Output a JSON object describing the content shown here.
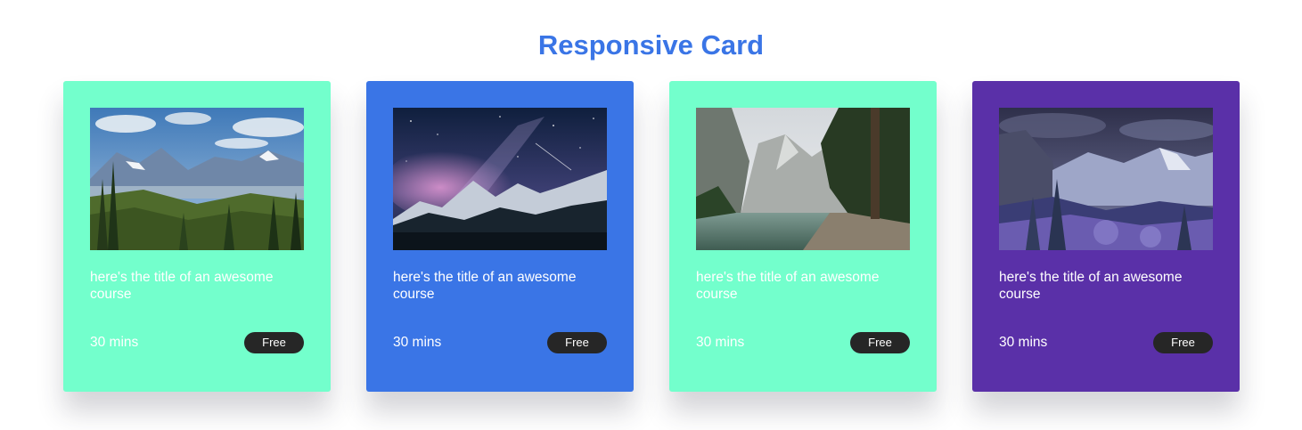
{
  "page": {
    "title": "Responsive Card"
  },
  "cards": [
    {
      "title": "here's the title of an awesome course",
      "duration": "30 mins",
      "badge": "Free",
      "color": "#73ffcc",
      "image": "mountain-valley-forest-image"
    },
    {
      "title": "here's the title of an awesome course",
      "duration": "30 mins",
      "badge": "Free",
      "color": "#3a75e6",
      "image": "milky-way-mountains-image"
    },
    {
      "title": "here's the title of an awesome course",
      "duration": "30 mins",
      "badge": "Free",
      "color": "#73ffcc",
      "image": "mountain-lake-image"
    },
    {
      "title": "here's the title of an awesome course",
      "duration": "30 mins",
      "badge": "Free",
      "color": "#5a30a8",
      "image": "snowy-valley-image"
    }
  ]
}
